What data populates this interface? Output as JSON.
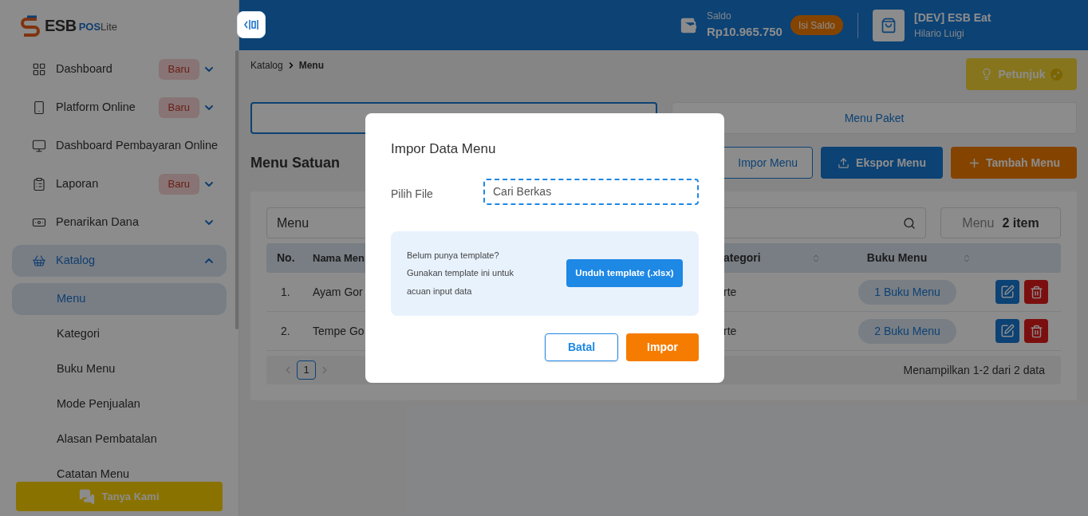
{
  "sidebar": {
    "logo": {
      "brand": "ESB",
      "product": "POS",
      "suffix": "Lite"
    },
    "items": [
      {
        "label": "Dashboard",
        "badge": "Baru",
        "expanded": false,
        "selected": false
      },
      {
        "label": "Platform Online",
        "badge": "Baru",
        "expanded": false,
        "selected": false
      },
      {
        "label": "Dashboard Pembayaran Online",
        "selected": false
      },
      {
        "label": "Laporan",
        "badge": "Baru",
        "expanded": false,
        "selected": false
      },
      {
        "label": "Penarikan Dana",
        "expanded": false,
        "selected": false
      },
      {
        "label": "Katalog",
        "expanded": true,
        "selected": true,
        "children": [
          {
            "label": "Menu",
            "selected": true
          },
          {
            "label": "Kategori",
            "selected": false
          },
          {
            "label": "Buku Menu",
            "selected": false
          },
          {
            "label": "Mode Penjualan",
            "selected": false
          },
          {
            "label": "Alasan Pembatalan",
            "selected": false
          },
          {
            "label": "Catatan Menu",
            "selected": false
          }
        ]
      }
    ],
    "help_button": "Tanya Kami"
  },
  "header": {
    "balance_label": "Saldo",
    "balance": "Rp10.965.750",
    "topup_button": "Isi Saldo",
    "store_name": "[DEV] ESB Eat",
    "user_name": "Hilario Luigi"
  },
  "breadcrumb": [
    "Katalog",
    "Menu"
  ],
  "guide_button": "Petunjuk",
  "tabs": [
    {
      "selected": true
    },
    {
      "label": "Menu Paket",
      "selected": false
    }
  ],
  "section_title": "Menu Satuan",
  "actions": [
    {
      "kind": "outline",
      "label": "Impor Menu"
    },
    {
      "kind": "export",
      "label": "Ekspor Menu"
    },
    {
      "kind": "add",
      "label": "Tambah Menu"
    }
  ],
  "table": {
    "search_value": "Menu",
    "count_label": "Menu",
    "count": "2 item",
    "columns": [
      "No.",
      "Nama Men",
      "ategori",
      "Buku Menu"
    ],
    "rows": [
      {
        "no": "1.",
        "name": "Ayam Gor",
        "category": "rte",
        "books": "1 Buku Menu"
      },
      {
        "no": "2.",
        "name": "Tempe Go",
        "category": "rte",
        "books": "2 Buku Menu"
      }
    ],
    "pagination": {
      "pages": [
        {
          "label": "1",
          "selected": true
        }
      ],
      "summary": "Menampilkan 1-2 dari 2 data"
    }
  },
  "dialog": {
    "title": "Impor Data Menu",
    "file_label": "Pilih File",
    "file_placeholder": "Cari Berkas",
    "info_lines": [
      "Belum punya template?",
      "Gunakan template ini untuk",
      "acuan input data"
    ],
    "download_button": "Unduh template (.xlsx)",
    "cancel_button": "Batal",
    "submit_button": "Impor"
  }
}
